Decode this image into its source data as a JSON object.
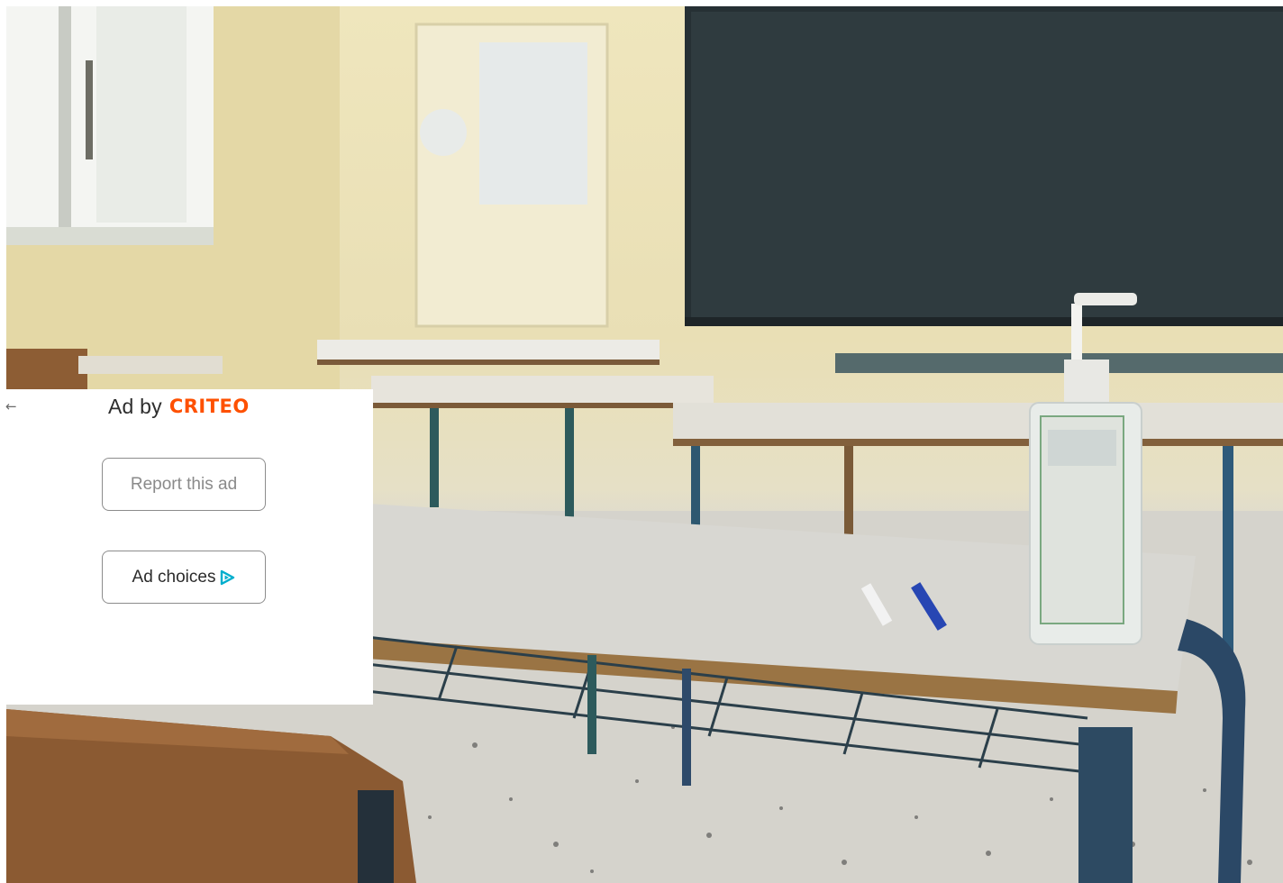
{
  "ad_overlay": {
    "back_icon": "arrow-left-icon",
    "ad_by_label": "Ad by",
    "brand": "CRITEO",
    "brand_color": "#fe5000",
    "report_label": "Report this ad",
    "choices_label": "Ad choices",
    "choices_icon": "adchoices-triangle-icon",
    "choices_icon_color": "#00aecd"
  },
  "background": {
    "scene": "classroom-photo"
  }
}
